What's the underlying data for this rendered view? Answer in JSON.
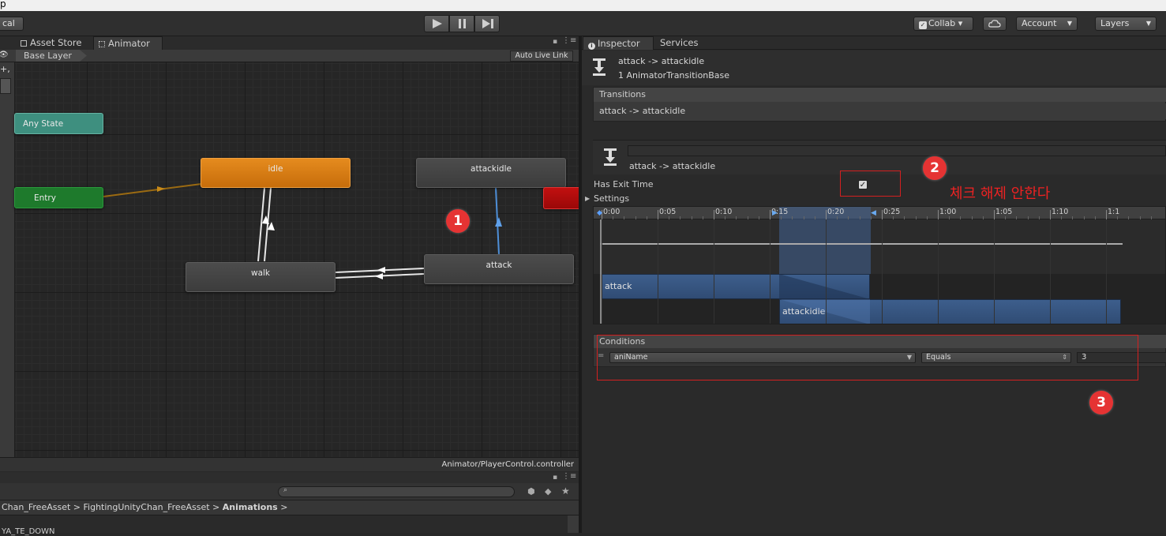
{
  "top_strip": {
    "text": "p"
  },
  "toolbar": {
    "left_label": "cal",
    "collab": "Collab ▾",
    "account": "Account",
    "layers": "Layers"
  },
  "animator_panel": {
    "tabs": [
      "Asset Store",
      "Animator"
    ],
    "layer": "Base Layer",
    "auto_live_link": "Auto Live Link",
    "states": {
      "any_state": "Any State",
      "entry": "Entry",
      "idle": "idle",
      "attackidle": "attackidle",
      "walk": "walk",
      "attack": "attack"
    },
    "controller_path": "Animator/PlayerControl.controller"
  },
  "project_panel": {
    "breadcrumb": [
      "Chan_FreeAsset",
      "FightingUnityChan_FreeAsset",
      "Animations"
    ],
    "list_item_partial": "YA_TE_DOWN"
  },
  "inspector": {
    "tabs": [
      "Inspector",
      "Services"
    ],
    "header_title": "attack -> attackidle",
    "header_subtitle": "1 AnimatorTransitionBase",
    "transitions_label": "Transitions",
    "transition_item": "attack -> attackidle",
    "transition_name": "attack -> attackidle",
    "has_exit_time_label": "Has Exit Time",
    "has_exit_time": true,
    "settings_label": "Settings",
    "timeline_ticks": [
      "0:00",
      "0:05",
      "0:10",
      "0:15",
      "0:20",
      "0:25",
      "1:00",
      "1:05",
      "1:10",
      "1:1"
    ],
    "clips": [
      "attack",
      "attackidle"
    ],
    "conditions_label": "Conditions",
    "condition": {
      "parameter": "aniName",
      "mode": "Equals",
      "value": "3"
    }
  },
  "annotations": {
    "badge_1": "1",
    "badge_2": "2",
    "badge_3": "3",
    "note": "체크 해제 안한다",
    "color": "#e53333"
  }
}
